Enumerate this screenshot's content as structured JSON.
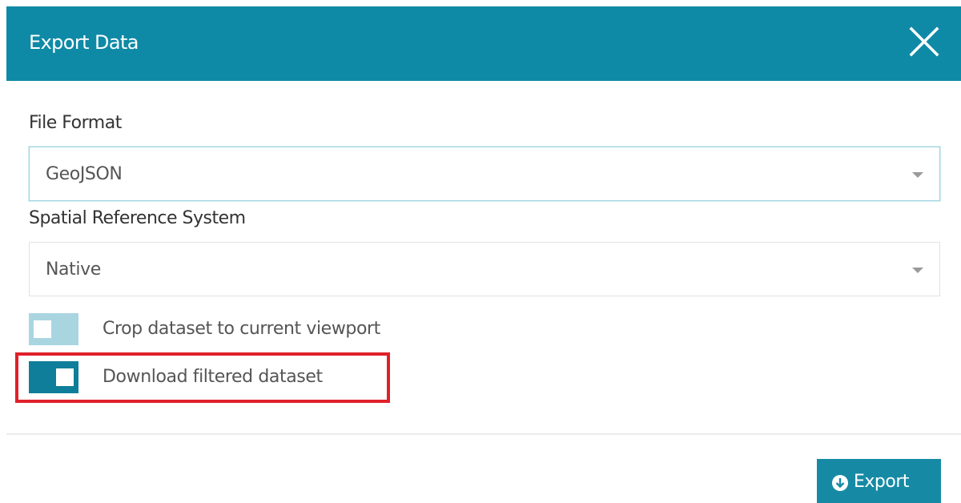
{
  "dialog": {
    "title": "Export Data",
    "close_icon": "close-icon"
  },
  "file_format": {
    "label": "File Format",
    "value": "GeoJSON"
  },
  "spatial_reference": {
    "label": "Spatial Reference System",
    "value": "Native"
  },
  "options": {
    "crop": {
      "label": "Crop dataset to current viewport",
      "enabled": false
    },
    "filtered": {
      "label": "Download filtered dataset",
      "enabled": true
    }
  },
  "footer": {
    "export_label": "Export",
    "export_icon": "download-circle-icon"
  },
  "colors": {
    "header": "#0e8aa6",
    "toggle_on": "#0e7e9a",
    "toggle_off": "#a9d5e1",
    "highlight": "#e0202a",
    "export_button": "#168aa5"
  }
}
